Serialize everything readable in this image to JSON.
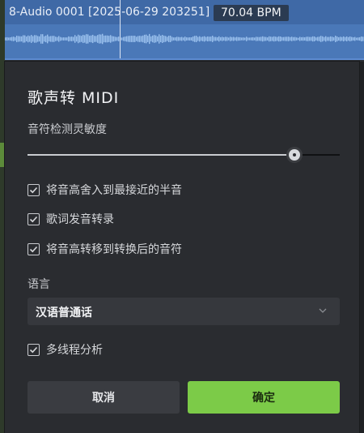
{
  "clip": {
    "title": "8-Audio 0001 [2025-06-29 203251]",
    "bpm": "70.04 BPM"
  },
  "dialog": {
    "title": "歌声转 MIDI",
    "sensitivity_label": "音符检测灵敏度",
    "sensitivity_value": 0.855,
    "options": [
      {
        "label": "将音高舍入到最接近的半音",
        "checked": true
      },
      {
        "label": "歌词发音转录",
        "checked": true
      },
      {
        "label": "将音高转移到转换后的音符",
        "checked": true
      }
    ],
    "language_label": "语言",
    "language_value": "汉语普通话",
    "multithread_label": "多线程分析",
    "multithread_checked": true,
    "cancel_label": "取消",
    "ok_label": "确定"
  },
  "colors": {
    "clip": "#4a78b8",
    "accent": "#7ccb48",
    "dialog_bg": "#2a2c30"
  }
}
